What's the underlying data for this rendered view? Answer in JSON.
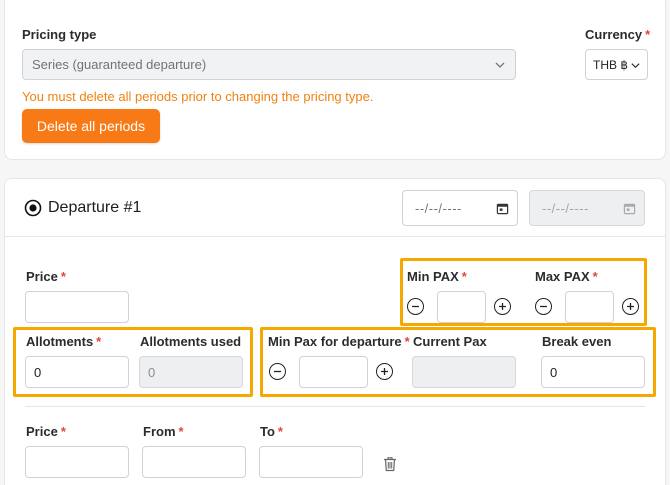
{
  "pricing": {
    "type_label": "Pricing type",
    "type_value": "Series (guaranteed departure)",
    "currency_label": "Currency",
    "currency_value": "THB ฿",
    "warning": "You must delete all periods prior to changing the pricing type.",
    "delete_button": "Delete all periods"
  },
  "departure": {
    "title": "Departure #1",
    "date_placeholder": "--/--/----",
    "date_end_placeholder": "--/--/----",
    "price_label": "Price",
    "min_pax_label": "Min PAX",
    "max_pax_label": "Max PAX",
    "min_pax_value": "",
    "max_pax_value": "",
    "allotments_label": "Allotments",
    "allotments_value": "0",
    "allotments_used_label": "Allotments used",
    "allotments_used_value": "0",
    "min_pax_departure_label": "Min Pax for departure",
    "min_pax_departure_value": "",
    "current_pax_label": "Current Pax",
    "current_pax_value": "",
    "break_even_label": "Break even",
    "break_even_value": "0"
  },
  "period": {
    "price_label": "Price",
    "from_label": "From",
    "to_label": "To"
  },
  "colors": {
    "accent": "#f77a16",
    "warning": "#f0820f",
    "highlight": "#f5a800",
    "required": "#e0483a"
  },
  "icons": [
    "chevron-down-icon",
    "radio-selected-icon",
    "calendar-icon",
    "minus-circle-icon",
    "plus-circle-icon",
    "trash-icon"
  ]
}
